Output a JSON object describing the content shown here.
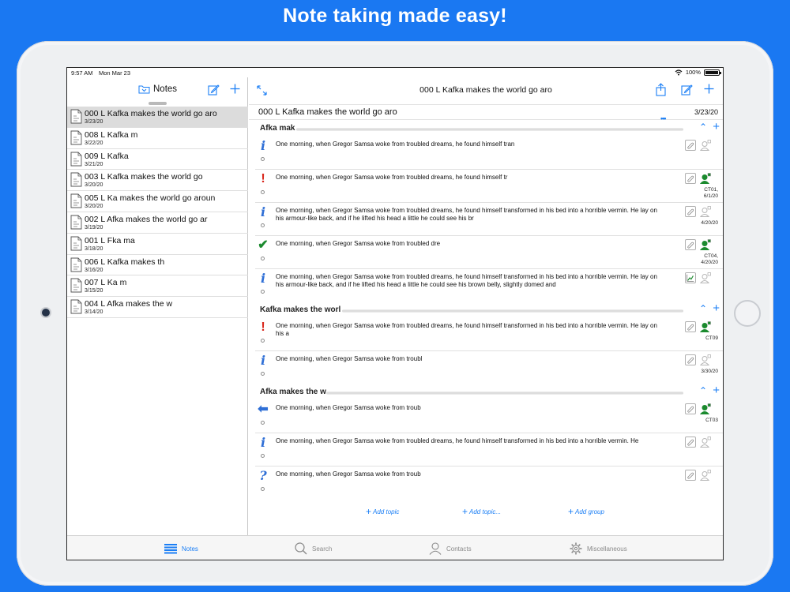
{
  "headline": "Note taking made easy!",
  "status": {
    "time": "9:57 AM",
    "date": "Mon Mar 23",
    "battery": "100%",
    "battery_level": 1.0
  },
  "sidebar": {
    "title": "Notes",
    "notes": [
      {
        "title": "000 L Kafka makes the world go aro",
        "date": "3/23/20",
        "selected": true
      },
      {
        "title": "008 L Kafka m",
        "date": "3/22/20"
      },
      {
        "title": "009 L Kafka",
        "date": "3/21/20"
      },
      {
        "title": "003 L Kafka makes the world go",
        "date": "3/20/20"
      },
      {
        "title": "005 L Ka makes the world go aroun",
        "date": "3/20/20"
      },
      {
        "title": "002 L Afka makes the world go ar",
        "date": "3/19/20"
      },
      {
        "title": "001 L Fka ma",
        "date": "3/18/20"
      },
      {
        "title": "006 L Kafka makes th",
        "date": "3/16/20"
      },
      {
        "title": "007 L Ka m",
        "date": "3/15/20"
      },
      {
        "title": "004 L Afka makes the w",
        "date": "3/14/20"
      }
    ]
  },
  "detail": {
    "nav_title": "000 L Kafka makes the world go aro",
    "doc_title": "000 L Kafka makes the world go aro",
    "doc_date": "3/23/20",
    "more": "•••",
    "groups": [
      {
        "name": "Afka mak",
        "entries": [
          {
            "icon": "info",
            "text": "One morning, when Gregor Samsa woke from troubled dreams, he found himself tran",
            "label": "",
            "assigned": false
          },
          {
            "icon": "exclamation",
            "text": "One morning, when Gregor Samsa woke from troubled dreams, he found himself tr",
            "label": "CT01,\n6/1/20",
            "assigned": true
          },
          {
            "icon": "info",
            "text": "One morning, when Gregor Samsa woke from troubled dreams, he found himself transformed in his bed into a horrible vermin. He lay on his armour-like back, and if he lifted his head a little he could see his br",
            "label": "4/20/20",
            "assigned": false
          },
          {
            "icon": "check",
            "text": "One morning, when Gregor Samsa woke from troubled dre",
            "label": "CT04,\n4/20/20",
            "assigned": true
          },
          {
            "icon": "info",
            "text": "One morning, when Gregor Samsa woke from troubled dreams, he found himself transformed in his bed into a horrible vermin. He lay on his armour-like back, and if he lifted his head a little he could see his brown belly, slightly domed and",
            "label": "",
            "assigned": false,
            "chart": true
          }
        ]
      },
      {
        "name": "Kafka makes the worl",
        "entries": [
          {
            "icon": "exclamation",
            "text": "One morning, when Gregor Samsa woke from troubled dreams, he found himself transformed in his bed into a horrible vermin. He lay on his a",
            "label": "CT09",
            "assigned": true
          },
          {
            "icon": "info",
            "text": "One morning, when Gregor Samsa woke from troubl",
            "label": "3/30/20",
            "assigned": false
          }
        ]
      },
      {
        "name": "Afka makes the w",
        "entries": [
          {
            "icon": "arrow",
            "text": "One morning, when Gregor Samsa woke from troub",
            "label": "CT03",
            "assigned": true
          },
          {
            "icon": "info",
            "text": "One morning, when Gregor Samsa woke from troubled dreams, he found himself transformed in his bed into a horrible vermin. He",
            "label": "",
            "assigned": false
          },
          {
            "icon": "question",
            "text": "One morning, when Gregor Samsa woke from troub",
            "label": "",
            "assigned": false
          }
        ]
      }
    ],
    "add_topic": "Add topic",
    "add_topic_more": "Add topic...",
    "add_group": "Add group"
  },
  "tabs": [
    {
      "label": "Notes",
      "icon": "list-icon",
      "active": true
    },
    {
      "label": "Search",
      "icon": "search-icon",
      "active": false
    },
    {
      "label": "Contacts",
      "icon": "person-icon",
      "active": false
    },
    {
      "label": "Miscellaneous",
      "icon": "gear-icon",
      "active": false
    }
  ],
  "colors": {
    "background": "#1a78f2",
    "accent": "#1a7ef5",
    "selected_row": "#dcdcdc",
    "green": "#1b8a2e",
    "red": "#d9271c"
  }
}
